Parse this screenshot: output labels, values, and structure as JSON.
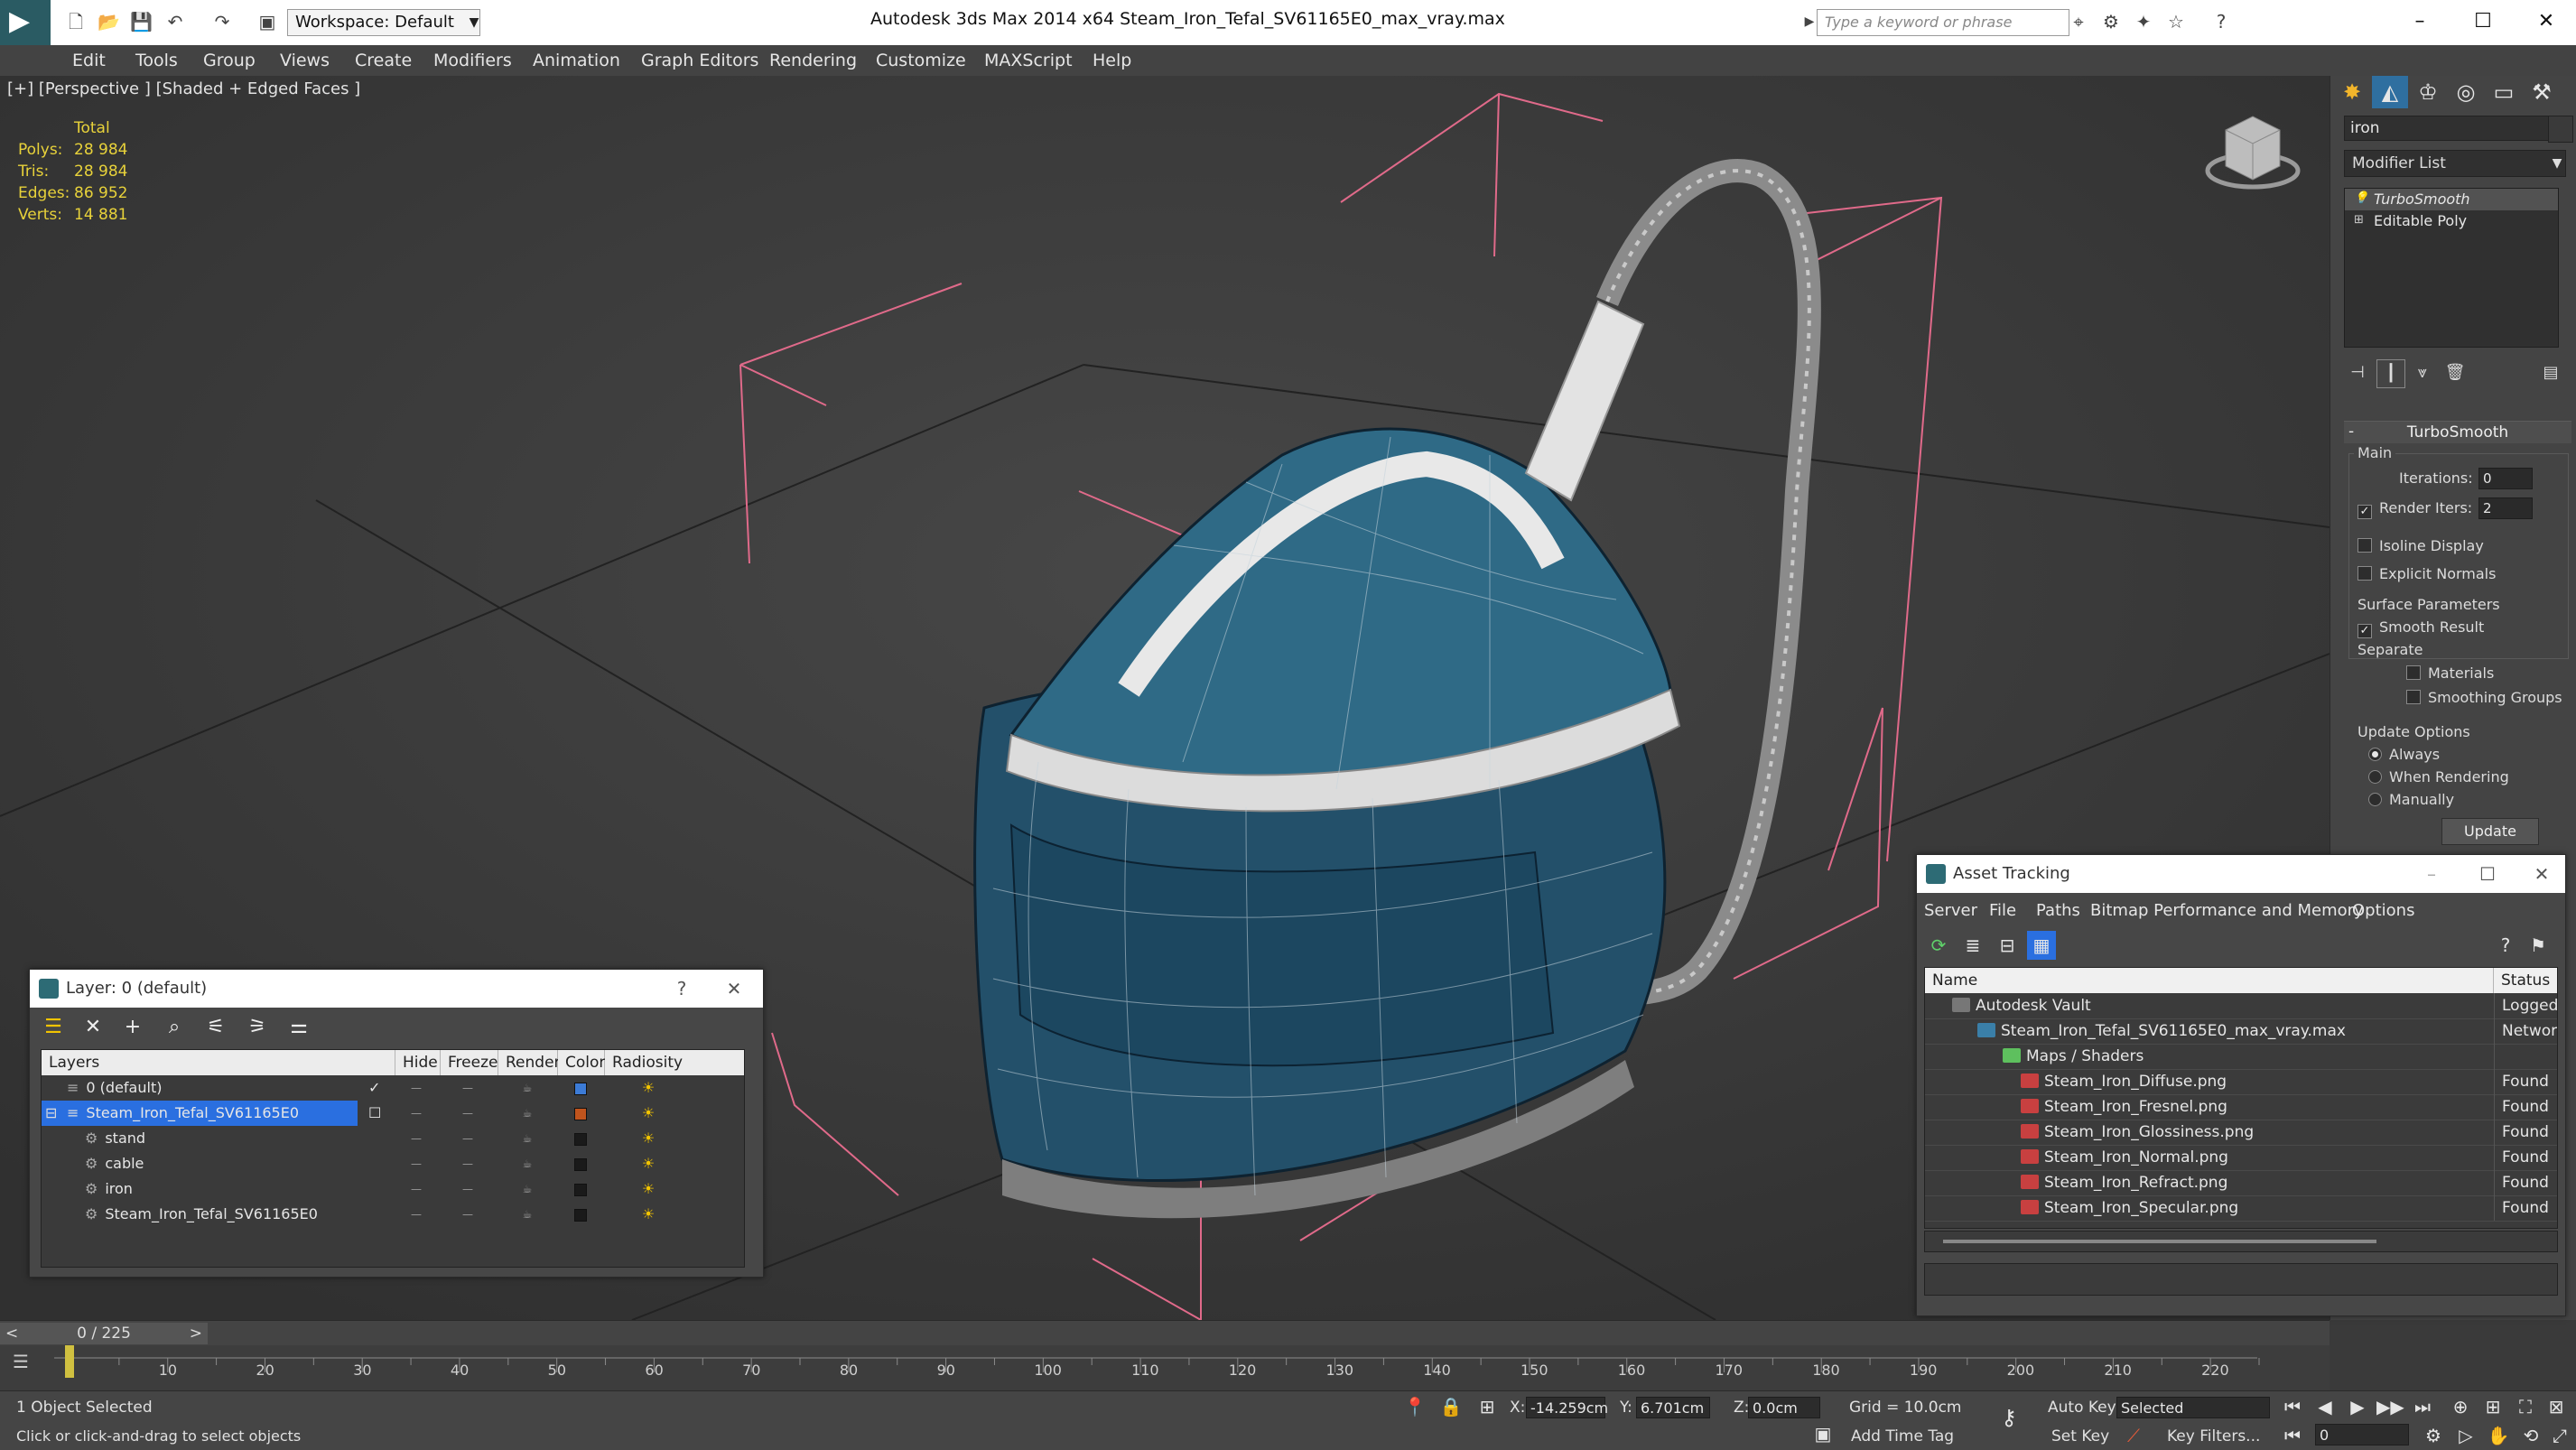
{
  "titlebar": {
    "workspace": "Workspace: Default",
    "title": "Autodesk 3ds Max  2014 x64     Steam_Iron_Tefal_SV61165E0_max_vray.max",
    "search_placeholder": "Type a keyword or phrase"
  },
  "menu": [
    "Edit",
    "Tools",
    "Group",
    "Views",
    "Create",
    "Modifiers",
    "Animation",
    "Graph Editors",
    "Rendering",
    "Customize",
    "MAXScript",
    "Help"
  ],
  "viewport": {
    "label": "[+] [Perspective ] [Shaded + Edged Faces ]",
    "stats": {
      "total": "Total",
      "polys_label": "Polys:",
      "polys": "28 984",
      "tris_label": "Tris:",
      "tris": "28 984",
      "edges_label": "Edges:",
      "edges": "86 952",
      "verts_label": "Verts:",
      "verts": "14 881"
    }
  },
  "command_panel": {
    "object_name": "iron",
    "modifier_list": "Modifier List",
    "stack": [
      "TurboSmooth",
      "Editable Poly"
    ],
    "rollout": "TurboSmooth",
    "main": "Main",
    "iterations_label": "Iterations:",
    "iterations": "0",
    "render_iters_label": "Render Iters:",
    "render_iters": "2",
    "isoline": "Isoline Display",
    "explicit": "Explicit Normals",
    "surface": "Surface Parameters",
    "smooth_result": "Smooth Result",
    "separate": "Separate",
    "materials": "Materials",
    "smoothing_groups": "Smoothing Groups",
    "update_options": "Update Options",
    "always": "Always",
    "when_rendering": "When Rendering",
    "manually": "Manually",
    "update": "Update"
  },
  "layer_window": {
    "title": "Layer: 0 (default)",
    "columns": [
      "Layers",
      "Hide",
      "Freeze",
      "Render",
      "Color",
      "Radiosity"
    ],
    "rows": [
      {
        "name": "0 (default)",
        "color": "#3c7bd6"
      },
      {
        "name": "Steam_Iron_Tefal_SV61165E0",
        "color": "#c0541d"
      },
      {
        "name": "stand",
        "color": "#1a1a1a"
      },
      {
        "name": "cable",
        "color": "#1a1a1a"
      },
      {
        "name": "iron",
        "color": "#1a1a1a"
      },
      {
        "name": "Steam_Iron_Tefal_SV61165E0",
        "color": "#1a1a1a"
      }
    ]
  },
  "asset_window": {
    "title": "Asset Tracking",
    "menu": [
      "Server",
      "File",
      "Paths",
      "Bitmap Performance and Memory",
      "Options"
    ],
    "columns": [
      "Name",
      "Status"
    ],
    "rows": [
      {
        "name": "Autodesk Vault",
        "status": "Logged Ou"
      },
      {
        "name": "Steam_Iron_Tefal_SV61165E0_max_vray.max",
        "status": "Network P"
      },
      {
        "name": "Maps / Shaders",
        "status": ""
      },
      {
        "name": "Steam_Iron_Diffuse.png",
        "status": "Found"
      },
      {
        "name": "Steam_Iron_Fresnel.png",
        "status": "Found"
      },
      {
        "name": "Steam_Iron_Glossiness.png",
        "status": "Found"
      },
      {
        "name": "Steam_Iron_Normal.png",
        "status": "Found"
      },
      {
        "name": "Steam_Iron_Refract.png",
        "status": "Found"
      },
      {
        "name": "Steam_Iron_Specular.png",
        "status": "Found"
      }
    ]
  },
  "timeline": {
    "frame": "0 / 225",
    "ticks": [
      "10",
      "20",
      "30",
      "40",
      "50",
      "60",
      "70",
      "80",
      "90",
      "100",
      "110",
      "120",
      "130",
      "140",
      "150",
      "160",
      "170",
      "180",
      "190",
      "200",
      "210",
      "220"
    ]
  },
  "status": {
    "selected": "1 Object Selected",
    "hint": "Click or click-and-drag to select objects",
    "x_label": "X:",
    "x": "-14.259cm",
    "y_label": "Y:",
    "y": "6.701cm",
    "z_label": "Z:",
    "z": "0.0cm",
    "grid": "Grid = 10.0cm",
    "auto_key": "Auto Key",
    "set_key": "Set Key",
    "selected_dd": "Selected",
    "key_filters": "Key Filters...",
    "add_time_tag": "Add Time Tag",
    "frame_field": "0"
  }
}
